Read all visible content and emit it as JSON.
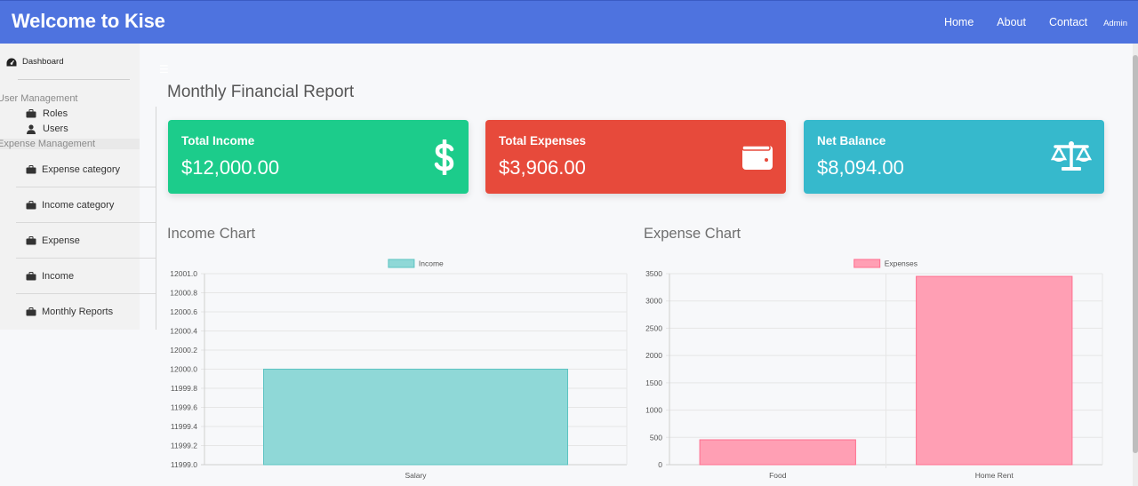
{
  "navbar": {
    "brand": "Welcome to Kise",
    "links": [
      "Home",
      "About",
      "Contact"
    ],
    "user": "Admin",
    "color": "#4e73df"
  },
  "sidebar": {
    "dashboard": "Dashboard",
    "user_management": "User Management",
    "roles": "Roles",
    "users": "Users",
    "expense_management": "Expense Management",
    "items": [
      "Expense category",
      "Income category",
      "Expense",
      "Income",
      "Monthly Reports"
    ]
  },
  "page": {
    "title": "Monthly Financial Report"
  },
  "cards": {
    "income": {
      "label": "Total Income",
      "value": "$12,000.00",
      "icon": "dollar-icon",
      "color": "#1ccc8b"
    },
    "expenses": {
      "label": "Total Expenses",
      "value": "$3,906.00",
      "icon": "wallet-icon",
      "color": "#e74a3b"
    },
    "net": {
      "label": "Net Balance",
      "value": "$8,094.00",
      "icon": "balance-scale-icon",
      "color": "#36b9cc"
    }
  },
  "charts": {
    "income_title": "Income Chart",
    "expense_title": "Expense Chart"
  },
  "chart_data": [
    {
      "type": "bar",
      "categories": [
        "Salary"
      ],
      "series": [
        {
          "name": "Income",
          "values": [
            12000
          ]
        }
      ],
      "ylim": [
        11999.0,
        12001.0
      ],
      "yticks": [
        "12001.0",
        "12000.8",
        "12000.6",
        "12000.4",
        "12000.2",
        "12000.0",
        "11999.8",
        "11999.6",
        "11999.4",
        "11999.2",
        "11999.0"
      ],
      "legend": "top",
      "grid": true,
      "colors": {
        "fill": "#8fd8d7",
        "stroke": "#5cc3c2"
      }
    },
    {
      "type": "bar",
      "categories": [
        "Food",
        "Home Rent"
      ],
      "series": [
        {
          "name": "Expenses",
          "values": [
            456,
            3450
          ]
        }
      ],
      "ylim": [
        0,
        3500
      ],
      "yticks": [
        "3500",
        "3000",
        "2500",
        "2000",
        "1500",
        "1000",
        "500",
        "0"
      ],
      "legend": "top",
      "grid": true,
      "colors": {
        "fill": "#ff9fb4",
        "stroke": "#ff6f8f"
      }
    }
  ]
}
